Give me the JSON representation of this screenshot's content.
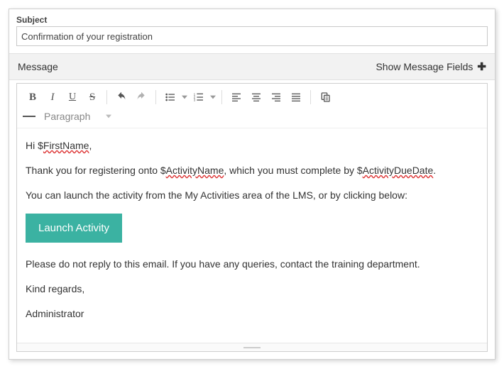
{
  "subject": {
    "label": "Subject",
    "value": "Confirmation of your registration"
  },
  "messageHeader": {
    "left": "Message",
    "right": "Show Message Fields"
  },
  "toolbar2": {
    "paragraph": "Paragraph"
  },
  "body": {
    "greet_pre": "Hi $",
    "greet_tok": "FirstName",
    "greet_post": ",",
    "p1_pre": "Thank you for registering onto $",
    "p1_tok": "ActivityName",
    "p1_mid": ", which you must complete by $",
    "p1_tok2": "ActivityDueDate",
    "p1_post": ".",
    "p2": "You can launch the activity from the My Activities area of the LMS, or by clicking below:",
    "button": "Launch Activity",
    "p3": "Please do not reply to this email. If you have any queries, contact the training department.",
    "p4": "Kind regards,",
    "p5": "Administrator"
  }
}
